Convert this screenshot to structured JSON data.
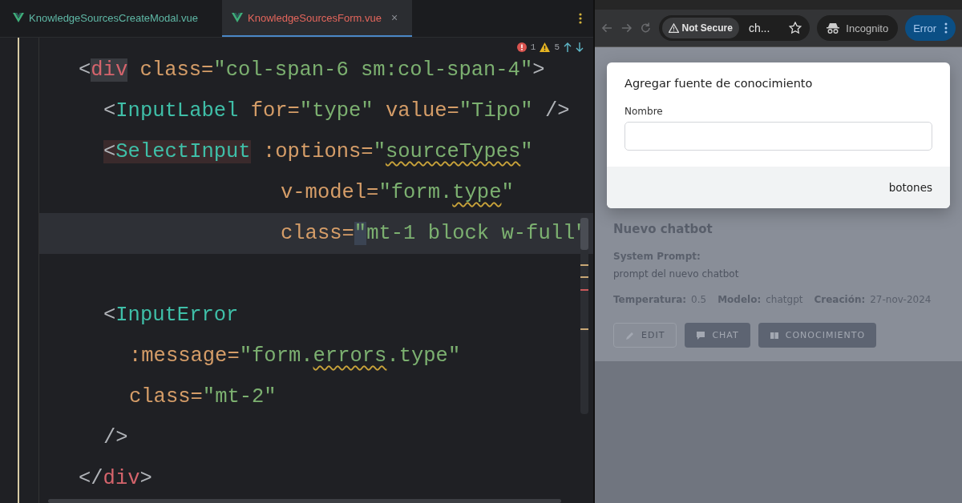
{
  "editor": {
    "tabs": [
      {
        "label": "KnowledgeSourcesCreateModal.vue",
        "selected": false,
        "modified": false
      },
      {
        "label": "KnowledgeSourcesForm.vue",
        "selected": true,
        "modified": true,
        "close": "×"
      }
    ],
    "inspections": {
      "errors": "1",
      "warnings": "5"
    },
    "lines": [
      {
        "current": false,
        "tokens": [
          {
            "kind": "punct",
            "text": "<"
          },
          {
            "kind": "tag",
            "text": "div",
            "matched": true
          },
          {
            "kind": "attr",
            "text": " class="
          },
          {
            "kind": "string",
            "text": "\"col-span-6 sm:col-span-4\""
          },
          {
            "kind": "punct",
            "text": ">"
          }
        ]
      },
      {
        "current": false,
        "tokens": [
          {
            "kind": "punct",
            "text": "<"
          },
          {
            "kind": "component",
            "text": "InputLabel"
          },
          {
            "kind": "attr",
            "text": " for="
          },
          {
            "kind": "string",
            "text": "\"type\""
          },
          {
            "kind": "attr",
            "text": " value="
          },
          {
            "kind": "string",
            "text": "\"Tipo\""
          },
          {
            "kind": "punct",
            "text": " />"
          }
        ]
      },
      {
        "current": false,
        "tokens": [
          {
            "kind": "punct",
            "text": "<",
            "error": true
          },
          {
            "kind": "component",
            "text": "SelectInput",
            "error": true
          },
          {
            "kind": "attr",
            "text": " :options="
          },
          {
            "kind": "string",
            "text": "\""
          },
          {
            "kind": "string",
            "text": "sourceTypes",
            "warning": true
          },
          {
            "kind": "string",
            "text": "\""
          }
        ]
      },
      {
        "current": false,
        "tokens": [
          {
            "kind": "attr",
            "text": "v-model="
          },
          {
            "kind": "string",
            "text": "\"form."
          },
          {
            "kind": "string",
            "text": "type",
            "warning": true
          },
          {
            "kind": "string",
            "text": "\""
          }
        ]
      },
      {
        "current": true,
        "tokens": [
          {
            "kind": "attr",
            "text": "class="
          },
          {
            "kind": "string",
            "text": "\"",
            "caret": true
          },
          {
            "kind": "string",
            "text": "mt-1 block w-full\""
          }
        ]
      },
      {
        "current": false,
        "tokens": [
          {
            "kind": "punct",
            "text": "<"
          },
          {
            "kind": "component",
            "text": "InputError"
          }
        ]
      },
      {
        "current": false,
        "tokens": [
          {
            "kind": "attr",
            "text": ":message="
          },
          {
            "kind": "string",
            "text": "\"form."
          },
          {
            "kind": "string",
            "text": "errors",
            "warning": true
          },
          {
            "kind": "string",
            "text": ".type\""
          }
        ]
      },
      {
        "current": false,
        "tokens": [
          {
            "kind": "attr",
            "text": "class="
          },
          {
            "kind": "string",
            "text": "\"mt-2\""
          }
        ]
      },
      {
        "current": false,
        "tokens": [
          {
            "kind": "punct",
            "text": "/>"
          }
        ]
      },
      {
        "current": false,
        "tokens": [
          {
            "kind": "punct",
            "text": "</"
          },
          {
            "kind": "tag",
            "text": "div"
          },
          {
            "kind": "punct",
            "text": ">"
          }
        ]
      }
    ]
  },
  "browser": {
    "security": "Not Secure",
    "address": "ch...",
    "incognito": "Incognito",
    "error_button": "Error",
    "page": {
      "title": "Nuevo chatbot",
      "prompt_label": "System Prompt:",
      "prompt": "prompt del nuevo chatbot",
      "meta": [
        {
          "label": "Temperatura:",
          "value": "0.5"
        },
        {
          "label": "Modelo:",
          "value": "chatgpt"
        },
        {
          "label": "Creación:",
          "value": "27-nov-2024"
        }
      ],
      "buttons": [
        {
          "label": "EDIT",
          "kind": "outline"
        },
        {
          "label": "CHAT",
          "kind": "solid"
        },
        {
          "label": "CONOCIMIENTO",
          "kind": "solid"
        }
      ]
    },
    "modal": {
      "title": "Agregar fuente de conocimiento",
      "field_label": "Nombre",
      "footer": "botones"
    }
  }
}
